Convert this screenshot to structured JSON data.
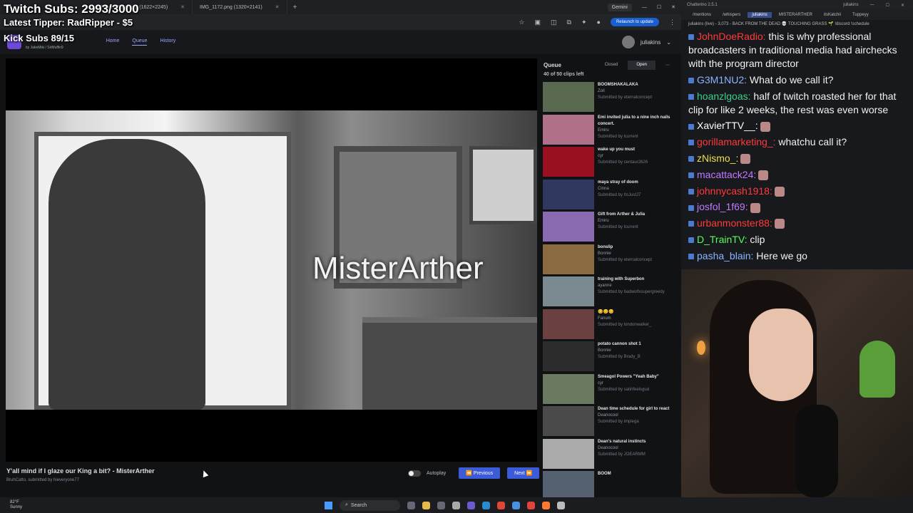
{
  "overlay": {
    "twitch_subs": "Twitch Subs: 2993/3000",
    "latest_tipper": "Latest Tipper: RadRipper - $5",
    "kick_subs": "Kick Subs 89/15"
  },
  "browser": {
    "tabs": [
      {
        "title": "Prison_Break.jpg (1622×2245)"
      },
      {
        "title": "IMG_1172.png (1320×2141)"
      }
    ],
    "gemini_label": "Gemini",
    "relaunch_label": "Relaunch to update"
  },
  "app": {
    "credits_by": "by",
    "credit_1": "JakeMiki",
    "credit_2": "SirMuffin9",
    "nav": [
      "Home",
      "Queue",
      "History"
    ],
    "username": "juliakins"
  },
  "player": {
    "watermark": "MisterArther",
    "clip_title": "Y'all mind if I glaze our King a bit? - MisterArther",
    "clip_author": "BruhCatto",
    "clip_submitted": ", submitted by hieveryone77",
    "autoplay_label": "Autoplay",
    "previous_label": "Previous",
    "next_label": "Next"
  },
  "queue": {
    "title": "Queue",
    "closed_label": "Closed",
    "open_label": "Open",
    "count": "40 of 50 clips left",
    "items": [
      {
        "title": "BOOMSHAKALAKA",
        "author": "Zoil",
        "submitter": "Submitted by eternalconcept",
        "thumb": "#5a6a50"
      },
      {
        "title": "Emi invited julia to a nine inch nails concert.",
        "author": "Emiru",
        "submitter": "Submitted by lcurrent",
        "thumb": "#b0708a"
      },
      {
        "title": "wake up you must",
        "author": "cyr",
        "submitter": "Submitted by centaur2626",
        "thumb": "#9a1020"
      },
      {
        "title": "maya stray of doom",
        "author": "Cinna",
        "submitter": "Submitted by ItsJustJ7",
        "thumb": "#303860"
      },
      {
        "title": "Gift from Arther & Julia",
        "author": "Emiru",
        "submitter": "Submitted by lcurrent",
        "thumb": "#8a6ab0"
      },
      {
        "title": "bonslip",
        "author": "Bonnie",
        "submitter": "Submitted by eternalconcept",
        "thumb": "#8a6a40"
      },
      {
        "title": "training with Superbon",
        "author": "ayanne",
        "submitter": "Submitted by badwolfxsupergreedy",
        "thumb": "#7a8a90"
      },
      {
        "title": "😊😊😊",
        "author": "Fanum",
        "submitter": "Submitted by londonwalker_",
        "thumb": "#6a4040"
      },
      {
        "title": "potato cannon shot 1",
        "author": "Bonnie",
        "submitter": "Submitted by Brady_B",
        "thumb": "#2c2c2c"
      },
      {
        "title": "Smeagol Powers \"Yeah Baby\"",
        "author": "cyr",
        "submitter": "Submitted by satinfeelsgud",
        "thumb": "#6a7a60"
      },
      {
        "title": "Dean time schedule for girl to react",
        "author": "Deanocool",
        "submitter": "Submitted by implega",
        "thumb": "#4a4a4a"
      },
      {
        "title": "Dean's natural instincts",
        "author": "Deanocool",
        "submitter": "Submitted by JOEARMM",
        "thumb": "#aaaaaa"
      },
      {
        "title": "BOOM",
        "author": "",
        "submitter": "",
        "thumb": "#556070"
      }
    ]
  },
  "chat": {
    "app_title": "Chatterino 2.5.1",
    "user_label": "juliakins",
    "tabs": [
      "/mentions",
      "/whispers",
      "juliakins",
      "MISTERARTHER",
      "itsKatchii",
      "Tuppeyy"
    ],
    "stream_line": "juliakins (live) - 3,073 - BACK FROM THE DEAD 💀 TOUCHING GRASS 🌱 !discord !schedule",
    "messages": [
      {
        "user": "JohnDoeRadio:",
        "color": "#ff3a3a",
        "text": " this is why professional broadcasters in traditional media had airchecks with the program director"
      },
      {
        "user": "G3M1NU2:",
        "color": "#8ab4ff",
        "text": " What do we call it?"
      },
      {
        "user": "hoanzlgoas:",
        "color": "#3ad08a",
        "text": " half of twitch roasted her for that clip for like 2 weeks, the rest was even worse"
      },
      {
        "user": "XavierTTV__:",
        "color": "#ffffff",
        "text": ""
      },
      {
        "user": "gorillamarketing_:",
        "color": "#ff3a3a",
        "text": " whatchu call it?"
      },
      {
        "user": "zNismo_:",
        "color": "#f0e040",
        "text": ""
      },
      {
        "user": "macattack24:",
        "color": "#c07aff",
        "text": ""
      },
      {
        "user": "johnnycash1918:",
        "color": "#ff3a3a",
        "text": ""
      },
      {
        "user": "josfol_1f69:",
        "color": "#c07aff",
        "text": ""
      },
      {
        "user": "urbanmonster88:",
        "color": "#ff3a3a",
        "text": ""
      },
      {
        "user": "D_TrainTV:",
        "color": "#5aff5a",
        "text": " clip"
      },
      {
        "user": "pasha_blain:",
        "color": "#8ab4ff",
        "text": " Here we go"
      }
    ]
  },
  "taskbar": {
    "temp": "82°F",
    "condition": "Sunny",
    "search_label": "Search"
  }
}
